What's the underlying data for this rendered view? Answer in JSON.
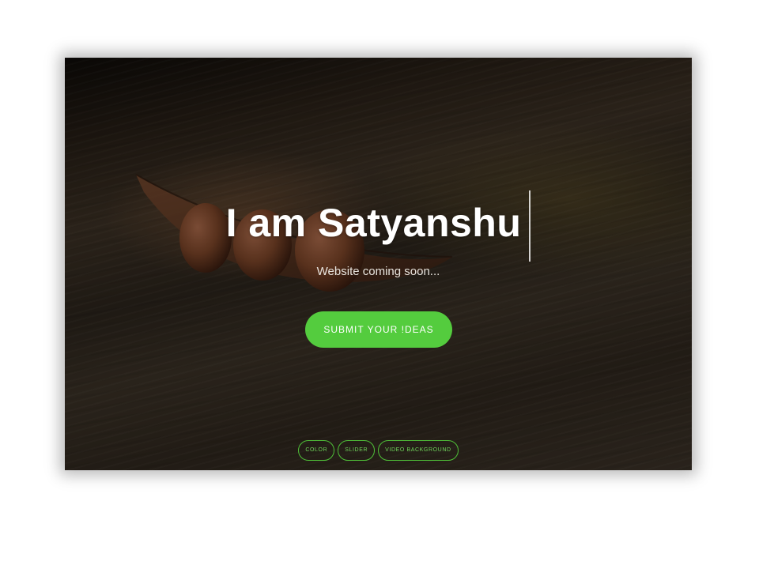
{
  "hero": {
    "title": "I am Satyanshu",
    "subtitle": "Website coming soon...",
    "cta_label": "SUBMIT YOUR !DEAS"
  },
  "variants": [
    {
      "label": "COLOR"
    },
    {
      "label": "SLIDER"
    },
    {
      "label": "VIDEO BACKGROUND"
    }
  ],
  "colors": {
    "accent": "#54cc3e",
    "background_tone": "#2f271e",
    "page": "#ffffff"
  },
  "icons": {
    "hero_image": "seeds-on-leaf-photo"
  }
}
